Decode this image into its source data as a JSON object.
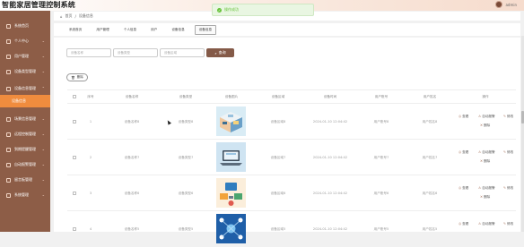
{
  "app": {
    "title": "智能家居管理控制系统",
    "user_name": "admin"
  },
  "toast": {
    "text": "操作成功"
  },
  "sidebar": {
    "items": [
      {
        "label": "系统首页",
        "expandable": false
      },
      {
        "label": "个人中心",
        "expandable": true
      },
      {
        "label": "用户管理",
        "expandable": true
      },
      {
        "label": "设备类型管理",
        "expandable": true
      },
      {
        "label": "设备信息管理",
        "expandable": true
      },
      {
        "label": "设备信息",
        "expandable": false,
        "active": true,
        "sub": true
      },
      {
        "label": "场景信息管理",
        "expandable": true
      },
      {
        "label": "远程控制管理",
        "expandable": true
      },
      {
        "label": "到期提醒管理",
        "expandable": true
      },
      {
        "label": "自动报警管理",
        "expandable": true
      },
      {
        "label": "留言板管理",
        "expandable": true
      },
      {
        "label": "系统管理",
        "expandable": true
      }
    ]
  },
  "breadcrumb": {
    "home": "首页",
    "separator": "/",
    "current": "设备信息"
  },
  "tabs": [
    {
      "label": "系统首页",
      "active": false
    },
    {
      "label": "用户管理",
      "active": false
    },
    {
      "label": "个人信息",
      "active": false
    },
    {
      "label": "用户",
      "active": false
    },
    {
      "label": "设备信息",
      "active": false
    },
    {
      "label": "设备信息",
      "active": true
    }
  ],
  "search": {
    "device_name_placeholder": "设备名称",
    "device_type_placeholder": "设备类型",
    "device_region_placeholder": "设备区域",
    "button_label": "查询"
  },
  "toolbar": {
    "delete_label": "删除"
  },
  "table": {
    "columns": [
      "序号",
      "设备名称",
      "设备类型",
      "设备图片",
      "设备区域",
      "设备时间",
      "用户账号",
      "用户姓名",
      "操作"
    ],
    "rows": [
      {
        "index": "1",
        "name": "设备名称8",
        "type": "设备类型8",
        "region": "设备区域8",
        "time": "2024-01-10 12:04:42",
        "account": "用户账号8",
        "user_name": "用户姓名8",
        "image": "room"
      },
      {
        "index": "2",
        "name": "设备名称7",
        "type": "设备类型7",
        "region": "设备区域7",
        "time": "2024-01-10 12:04:42",
        "account": "用户账号7",
        "user_name": "用户姓名7",
        "image": "laptop"
      },
      {
        "index": "3",
        "name": "设备名称6",
        "type": "设备类型6",
        "region": "设备区域6",
        "time": "2024-01-10 12:04:42",
        "account": "用户账号6",
        "user_name": "用户姓名6",
        "image": "devices"
      },
      {
        "index": "4",
        "name": "设备名称5",
        "type": "设备类型5",
        "region": "设备区域5",
        "time": "2024-01-10 12:04:42",
        "account": "用户账号5",
        "user_name": "用户姓名5",
        "image": "network"
      }
    ],
    "actions": {
      "view": "查看",
      "alarm": "自动报警",
      "edit": "修改",
      "delete": "删除"
    }
  },
  "colors": {
    "sidebar": "#8d5d47",
    "active": "#f08c3e",
    "accent": "#845a48",
    "toast": "#67c23a"
  }
}
